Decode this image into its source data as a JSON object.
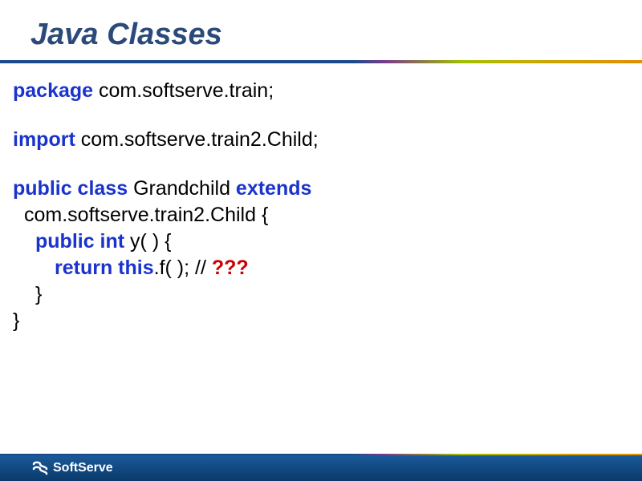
{
  "title": "Java Classes",
  "code": {
    "l1_kw": "package",
    "l1_rest": " com.softserve.train;",
    "l2_kw": "import",
    "l2_rest": " com.softserve.train2.Child;",
    "l3_kw1": "public class",
    "l3_mid": " Grandchild ",
    "l3_kw2": "extends",
    "l4": "com.softserve.train2.Child {",
    "l5_kw": "public int",
    "l5_rest": " y( ) {",
    "l6_kw": "return this",
    "l6_rest": ".f( ); // ",
    "l6_err": "???",
    "l7": "}",
    "l8": "}"
  },
  "footer": {
    "brand": "SoftServe"
  }
}
